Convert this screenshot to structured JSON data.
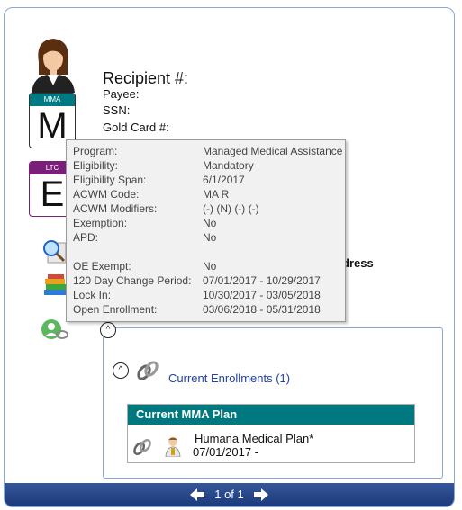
{
  "recipient": {
    "title": "Recipient #:",
    "payee_label": "Payee:",
    "ssn_label": "SSN:",
    "gold_card_label": "Gold Card #:"
  },
  "badges": {
    "mma": {
      "top": "MMA",
      "letter": "M",
      "color": "#007a82"
    },
    "ltc": {
      "top": "LTC",
      "letter": "E",
      "color": "#7b1e7a"
    }
  },
  "address_fragment": "dress",
  "tooltip": {
    "rows": [
      {
        "label": "Program:",
        "value": "Managed Medical Assistance"
      },
      {
        "label": "Eligibility:",
        "value": "Mandatory"
      },
      {
        "label": "Eligibility Span:",
        "value": "6/1/2017"
      },
      {
        "label": "ACWM Code:",
        "value": "MA R"
      },
      {
        "label": "ACWM Modifiers:",
        "value": "(-) (N) (-) (-)"
      },
      {
        "label": "Exemption:",
        "value": "No"
      },
      {
        "label": "APD:",
        "value": "No"
      },
      {
        "label": "",
        "value": ""
      },
      {
        "label": "OE Exempt:",
        "value": "No"
      },
      {
        "label": "120 Day Change Period:",
        "value": "07/01/2017 - 10/29/2017"
      },
      {
        "label": "Lock In:",
        "value": "10/30/2017 - 03/05/2018"
      },
      {
        "label": "Open Enrollment:",
        "value": "03/06/2018 - 05/31/2018"
      }
    ]
  },
  "enrollments": {
    "collapse_symbol": "^",
    "link_label": "Current Enrollments (1)",
    "plan_header": "Current MMA Plan",
    "plan_name": "Humana Medical Plan*",
    "plan_date": "07/01/2017 -"
  },
  "pager": {
    "label": "1 of 1",
    "prev_icon": "arrow-left-icon",
    "next_icon": "arrow-right-icon"
  },
  "colors": {
    "accent": "#1f3fa8",
    "plan_header": "#00787f",
    "footer": "#1b3a7a"
  }
}
